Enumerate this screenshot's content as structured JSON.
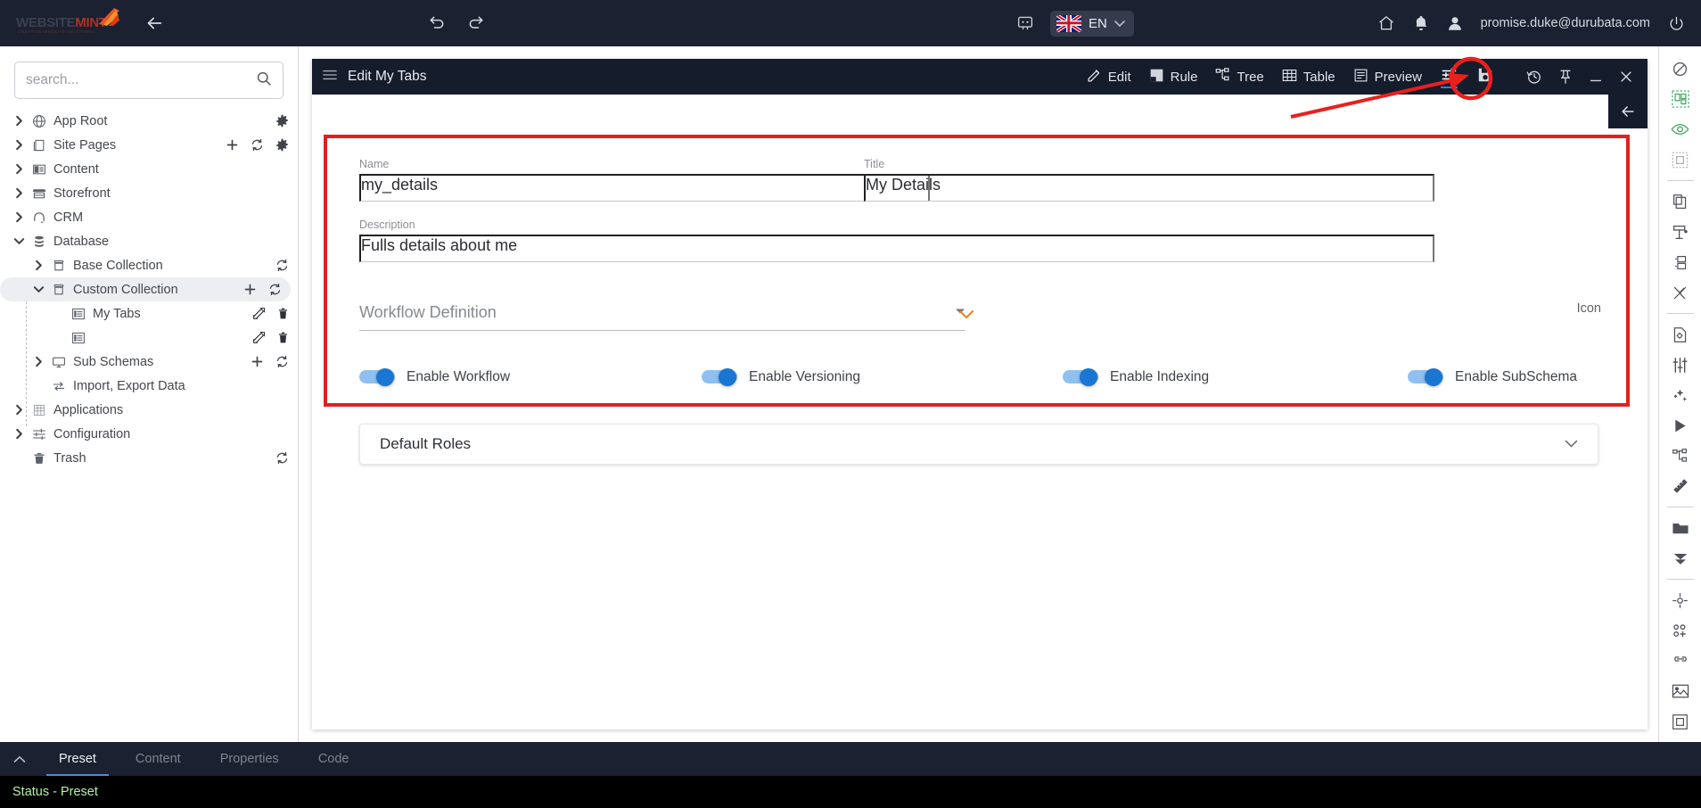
{
  "topbar": {
    "logo_primary": "WEBSITE",
    "logo_secondary": "MINT",
    "logo_tagline": "CREATIVE WEBSITE SOLUTIONS",
    "back_icon": "back-arrow-icon",
    "undo_icon": "undo-icon",
    "redo_icon": "redo-icon",
    "chat_icon": "chat-icon",
    "language": "EN",
    "lang_caret_icon": "chevron-down-icon",
    "home_icon": "home-icon",
    "bell_icon": "notification-bell-icon",
    "user_icon": "user-icon",
    "user_email": "promise.duke@durubata.com",
    "power_icon": "power-icon"
  },
  "sidebar": {
    "search_placeholder": "search...",
    "search_value": "",
    "search_icon": "search-icon",
    "items": [
      {
        "label": "App Root",
        "icon": "globe-icon",
        "indent": 0,
        "expander": "chevron-right",
        "selected": false,
        "actions": [
          "gear-icon"
        ]
      },
      {
        "label": "Site Pages",
        "icon": "pages-icon",
        "indent": 0,
        "expander": "chevron-right",
        "selected": false,
        "actions": [
          "plus-icon",
          "refresh-icon",
          "gear-icon"
        ]
      },
      {
        "label": "Content",
        "icon": "content-icon",
        "indent": 0,
        "expander": "chevron-right",
        "selected": false,
        "actions": []
      },
      {
        "label": "Storefront",
        "icon": "store-icon",
        "indent": 0,
        "expander": "chevron-right",
        "selected": false,
        "actions": []
      },
      {
        "label": "CRM",
        "icon": "headset-icon",
        "indent": 0,
        "expander": "chevron-right",
        "selected": false,
        "actions": []
      },
      {
        "label": "Database",
        "icon": "database-icon",
        "indent": 0,
        "expander": "chevron-down",
        "selected": false,
        "actions": []
      },
      {
        "label": "Base Collection",
        "icon": "box-icon",
        "indent": 1,
        "expander": "chevron-right",
        "selected": false,
        "actions": [
          "refresh-icon"
        ]
      },
      {
        "label": "Custom Collection",
        "icon": "box-icon",
        "indent": 1,
        "expander": "chevron-down",
        "selected": true,
        "actions": [
          "plus-icon",
          "refresh-icon"
        ]
      },
      {
        "label": "My Tabs",
        "icon": "list-icon",
        "indent": 2,
        "expander": "none",
        "selected": false,
        "actions": [
          "edit-icon",
          "delete-icon"
        ]
      },
      {
        "label": "",
        "icon": "list-icon",
        "indent": 2,
        "expander": "none",
        "selected": false,
        "actions": [
          "edit-icon",
          "delete-icon"
        ]
      },
      {
        "label": "Sub Schemas",
        "icon": "monitor-icon",
        "indent": 1,
        "expander": "chevron-right",
        "selected": false,
        "actions": [
          "plus-icon",
          "refresh-icon"
        ]
      },
      {
        "label": "Import, Export Data",
        "icon": "transfer-icon",
        "indent": 1,
        "expander": "none",
        "selected": false,
        "actions": []
      },
      {
        "label": "Applications",
        "icon": "apps-icon",
        "indent": 0,
        "expander": "chevron-right",
        "selected": false,
        "actions": []
      },
      {
        "label": "Configuration",
        "icon": "sliders-icon",
        "indent": 0,
        "expander": "chevron-right",
        "selected": false,
        "actions": []
      },
      {
        "label": "Trash",
        "icon": "trash-icon",
        "indent": 0,
        "expander": "none",
        "selected": false,
        "actions": [
          "refresh-icon"
        ]
      }
    ]
  },
  "panel": {
    "menu_icon": "hamburger-icon",
    "title": "Edit My Tabs",
    "tools": [
      {
        "label": "Edit",
        "icon": "edit-icon"
      },
      {
        "label": "Rule",
        "icon": "rule-icon"
      },
      {
        "label": "Tree",
        "icon": "tree-icon"
      },
      {
        "label": "Table",
        "icon": "table-icon"
      },
      {
        "label": "Preview",
        "icon": "preview-icon"
      }
    ],
    "settings_icon": "settings-sliders-icon",
    "save_icon": "save-icon",
    "history_icon": "history-icon",
    "pin_icon": "pin-icon",
    "minimize_icon": "minimize-icon",
    "close_icon": "close-icon",
    "collapse_icon": "collapse-left-icon"
  },
  "form": {
    "name_label": "Name",
    "name_value": "my_details",
    "title_label": "Title",
    "title_value": "My Details",
    "description_label": "Description",
    "description_value": "Fulls details about me",
    "workflow_placeholder": "Workflow Definition",
    "workflow_value": "",
    "workflow_caret_icon": "caret-down-icon",
    "workflow_expand_icon": "chevron-down-orange-icon",
    "icon_label": "Icon",
    "toggles": [
      {
        "label": "Enable Workflow",
        "on": true
      },
      {
        "label": "Enable Versioning",
        "on": true
      },
      {
        "label": "Enable Indexing",
        "on": true
      },
      {
        "label": "Enable SubSchema",
        "on": true
      }
    ],
    "roles_title": "Default Roles",
    "roles_caret_icon": "chevron-down-icon"
  },
  "right_toolbar": {
    "groups": [
      [
        "block-icon",
        "select-multiple-icon",
        "eye-icon",
        "dashed-square-icon"
      ],
      [
        "clipboard-icon",
        "paste-format-icon",
        "group-icon",
        "cut-disabled-icon"
      ],
      [
        "file-settings-icon",
        "sliders-vertical-icon",
        "magic-wand-icon",
        "play-icon",
        "hierarchy-icon",
        "ruler-icon"
      ],
      [
        "folder-icon",
        "download-icon"
      ],
      [
        "target-icon",
        "add-node-icon",
        "link-icon",
        "image-icon",
        "frame-icon"
      ]
    ]
  },
  "bottom": {
    "collapse_icon": "chevron-up-icon",
    "tabs": [
      {
        "label": "Preset",
        "active": true
      },
      {
        "label": "Content",
        "active": false
      },
      {
        "label": "Properties",
        "active": false
      },
      {
        "label": "Code",
        "active": false
      }
    ],
    "status_text": "Status - Preset"
  },
  "colors": {
    "accent_blue": "#1976d2",
    "annotation_red": "#e02020",
    "dark_chrome": "#1b2130",
    "panel_header": "#151c2c",
    "orange": "#e8842a",
    "status_green": "#b5f0a8"
  }
}
